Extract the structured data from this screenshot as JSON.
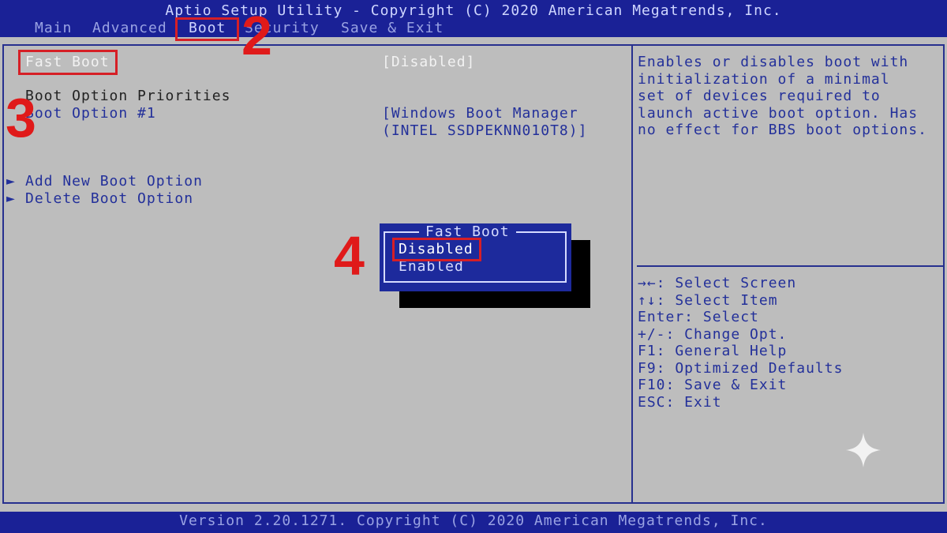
{
  "header": {
    "title": "Aptio Setup Utility - Copyright (C) 2020 American Megatrends, Inc.",
    "tabs": [
      {
        "label": "Main"
      },
      {
        "label": "Advanced"
      },
      {
        "label": "Boot"
      },
      {
        "label": "Security"
      },
      {
        "label": "Save & Exit"
      }
    ]
  },
  "boot": {
    "fast_boot_label": "Fast Boot",
    "fast_boot_value": "[Disabled]",
    "priorities_heading": "Boot Option Priorities",
    "option1_label": "Boot Option #1",
    "option1_value_line1": "[Windows Boot Manager",
    "option1_value_line2": "(INTEL SSDPEKNN010T8)]",
    "add_option": "Add New Boot Option",
    "delete_option": "Delete Boot Option",
    "arrow": "►"
  },
  "help": {
    "description": [
      "Enables or disables boot with",
      "initialization of a minimal",
      "set of devices required to",
      "launch active boot option. Has",
      "no effect for BBS boot options."
    ],
    "keys": [
      "→←: Select Screen",
      "↑↓: Select Item",
      "Enter: Select",
      "+/-: Change Opt.",
      "F1: General Help",
      "F9: Optimized Defaults",
      "F10: Save & Exit",
      "ESC: Exit"
    ]
  },
  "popup": {
    "title": "Fast Boot",
    "options": [
      "Disabled",
      "Enabled"
    ],
    "selected": "Disabled"
  },
  "annotations": {
    "step2": "2",
    "step3": "3",
    "step4": "4"
  },
  "footer": {
    "version": "Version 2.20.1271. Copyright (C) 2020 American Megatrends, Inc."
  },
  "colors": {
    "bar": "#1a2196",
    "background": "#bdbdbd",
    "annotation_red": "#e01a1a"
  },
  "icons": {
    "sparkle": "sparkle-icon",
    "submenu_arrow": "triangle-right-icon"
  }
}
